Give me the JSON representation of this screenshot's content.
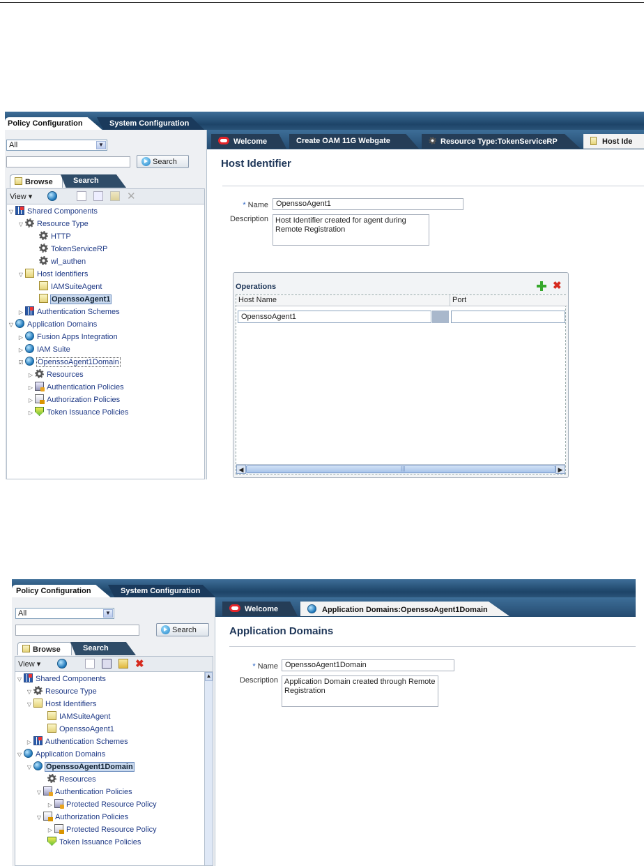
{
  "shot1": {
    "nav_tabs": [
      "Policy Configuration",
      "System Configuration"
    ],
    "filter_value": "All",
    "search_button": "Search",
    "left_tabs": [
      "Browse",
      "Search"
    ],
    "view_menu": "View ▾",
    "tree": [
      {
        "label": "Shared Components",
        "twisty": "▽",
        "icon": "grid-icon"
      },
      {
        "label": "Resource Type",
        "twisty": "▽",
        "icon": "gear-icon"
      },
      {
        "label": "HTTP",
        "twisty": "",
        "icon": "gear-icon"
      },
      {
        "label": "TokenServiceRP",
        "twisty": "",
        "icon": "gear-icon"
      },
      {
        "label": "wl_authen",
        "twisty": "",
        "icon": "gear-icon"
      },
      {
        "label": "Host Identifiers",
        "twisty": "▽",
        "icon": "document-icon"
      },
      {
        "label": "IAMSuiteAgent",
        "twisty": "",
        "icon": "document-icon"
      },
      {
        "label": "OpenssoAgent1",
        "twisty": "",
        "icon": "document-icon",
        "selected": true
      },
      {
        "label": "Authentication Schemes",
        "twisty": "▷",
        "icon": "grid-icon"
      },
      {
        "label": "Application Domains",
        "twisty": "▽",
        "icon": "globe-icon"
      },
      {
        "label": "Fusion Apps Integration",
        "twisty": "▷",
        "icon": "globe-icon"
      },
      {
        "label": "IAM Suite",
        "twisty": "▷",
        "icon": "globe-icon"
      },
      {
        "label": "OpenssoAgent1Domain",
        "twisty": "☑",
        "icon": "globe-icon"
      },
      {
        "label": "Resources",
        "twisty": "▷",
        "icon": "gear-icon"
      },
      {
        "label": "Authentication Policies",
        "twisty": "▷",
        "icon": "auth-policy-icon"
      },
      {
        "label": "Authorization Policies",
        "twisty": "▷",
        "icon": "authz-policy-icon"
      },
      {
        "label": "Token Issuance Policies",
        "twisty": "▷",
        "icon": "shield-icon"
      }
    ],
    "content_tabs": [
      "Welcome",
      "Create OAM 11G Webgate",
      "Resource Type:TokenServiceRP",
      "Host Ide"
    ],
    "page_title": "Host Identifier",
    "name_label": "Name",
    "name_value": "OpenssoAgent1",
    "description_label": "Description",
    "description_value": "Host Identifier created for agent during Remote Registration",
    "operations": {
      "title": "Operations",
      "columns": [
        "Host Name",
        "Port"
      ],
      "rows": [
        [
          "OpenssoAgent1",
          ""
        ]
      ],
      "scroll_grip": "|||"
    }
  },
  "shot2": {
    "nav_tabs": [
      "Policy Configuration",
      "System Configuration"
    ],
    "filter_value": "All",
    "search_button": "Search",
    "left_tabs": [
      "Browse",
      "Search"
    ],
    "view_menu": "View ▾",
    "tree": [
      {
        "label": "Shared Components",
        "twisty": "▽",
        "icon": "grid-icon"
      },
      {
        "label": "Resource Type",
        "twisty": "▽",
        "icon": "gear-icon"
      },
      {
        "label": "Host Identifiers",
        "twisty": "▽",
        "icon": "document-icon"
      },
      {
        "label": "IAMSuiteAgent",
        "twisty": "",
        "icon": "document-icon"
      },
      {
        "label": "OpenssoAgent1",
        "twisty": "",
        "icon": "document-icon"
      },
      {
        "label": "Authentication Schemes",
        "twisty": "▷",
        "icon": "grid-icon"
      },
      {
        "label": "Application Domains",
        "twisty": "▽",
        "icon": "globe-icon"
      },
      {
        "label": "OpenssoAgent1Domain",
        "twisty": "▽",
        "icon": "globe-icon",
        "selected": true
      },
      {
        "label": "Resources",
        "twisty": "",
        "icon": "gear-icon"
      },
      {
        "label": "Authentication Policies",
        "twisty": "▽",
        "icon": "auth-policy-icon"
      },
      {
        "label": "Protected Resource Policy",
        "twisty": "▷",
        "icon": "auth-policy-icon"
      },
      {
        "label": "Authorization Policies",
        "twisty": "▽",
        "icon": "authz-policy-icon"
      },
      {
        "label": "Protected Resource Policy",
        "twisty": "▷",
        "icon": "authz-policy-icon"
      },
      {
        "label": "Token Issuance Policies",
        "twisty": "",
        "icon": "shield-icon"
      }
    ],
    "content_tabs": [
      "Welcome",
      "Application Domains:OpenssoAgent1Domain"
    ],
    "page_title": "Application Domains",
    "name_label": "Name",
    "name_value": "OpenssoAgent1Domain",
    "description_label": "Description",
    "description_value": "Application Domain created through Remote Registration"
  }
}
